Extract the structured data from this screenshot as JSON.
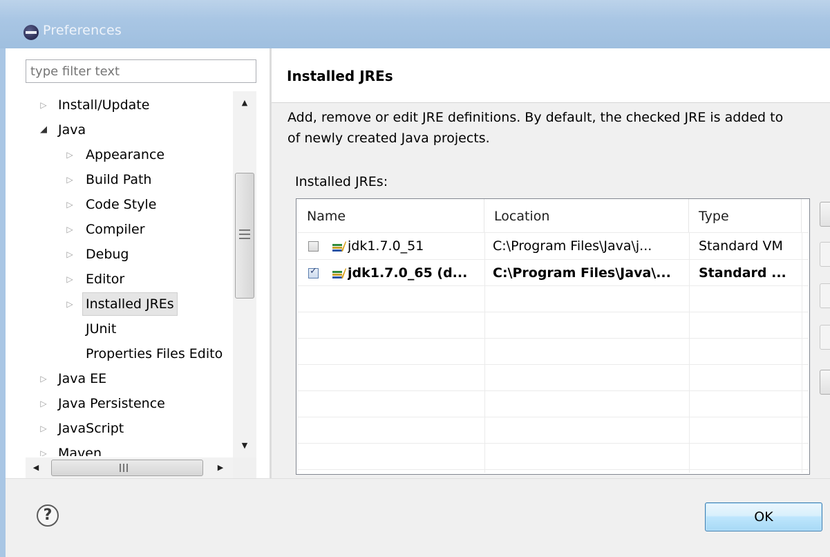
{
  "window": {
    "title": "Preferences"
  },
  "filter": {
    "placeholder": "type filter text"
  },
  "tree": {
    "items": [
      {
        "label": "Install/Update",
        "level": 0,
        "twisty": "collapsed"
      },
      {
        "label": "Java",
        "level": 0,
        "twisty": "expanded"
      },
      {
        "label": "Appearance",
        "level": 1,
        "twisty": "collapsed"
      },
      {
        "label": "Build Path",
        "level": 1,
        "twisty": "collapsed"
      },
      {
        "label": "Code Style",
        "level": 1,
        "twisty": "collapsed"
      },
      {
        "label": "Compiler",
        "level": 1,
        "twisty": "collapsed"
      },
      {
        "label": "Debug",
        "level": 1,
        "twisty": "collapsed"
      },
      {
        "label": "Editor",
        "level": 1,
        "twisty": "collapsed"
      },
      {
        "label": "Installed JREs",
        "level": 1,
        "twisty": "collapsed",
        "selected": true
      },
      {
        "label": "JUnit",
        "level": 1,
        "twisty": "none"
      },
      {
        "label": "Properties Files Edito",
        "level": 1,
        "twisty": "none"
      },
      {
        "label": "Java EE",
        "level": 0,
        "twisty": "collapsed"
      },
      {
        "label": "Java Persistence",
        "level": 0,
        "twisty": "collapsed"
      },
      {
        "label": "JavaScript",
        "level": 0,
        "twisty": "collapsed"
      },
      {
        "label": "Maven",
        "level": 0,
        "twisty": "collapsed"
      }
    ]
  },
  "page": {
    "title": "Installed JREs",
    "description_line1": "Add, remove or edit JRE definitions. By default, the checked JRE is added to",
    "description_line2": "of newly created Java projects.",
    "table_label": "Installed JREs:"
  },
  "table": {
    "columns": [
      "Name",
      "Location",
      "Type"
    ],
    "rows": [
      {
        "checked": false,
        "name": "jdk1.7.0_51",
        "location": "C:\\Program Files\\Java\\j...",
        "type": "Standard VM",
        "bold": false
      },
      {
        "checked": true,
        "name": "jdk1.7.0_65 (d...",
        "location": "C:\\Program Files\\Java\\...",
        "type": "Standard ...",
        "bold": true
      }
    ]
  },
  "icons": {
    "title": "eclipse-icon",
    "help": "help-icon",
    "jre": "jre-library-icon",
    "scroll_up": "▲",
    "scroll_down": "▼",
    "scroll_left": "◀",
    "scroll_right": "▶",
    "twisty_collapsed": "▷",
    "twisty_expanded": "◢",
    "help_glyph": "?"
  },
  "buttons": {
    "ok": "OK"
  },
  "colors": {
    "titlebar": "#a9c6e4",
    "ok_button_border": "#3c7fb1",
    "selection": "#e5e5e5"
  }
}
